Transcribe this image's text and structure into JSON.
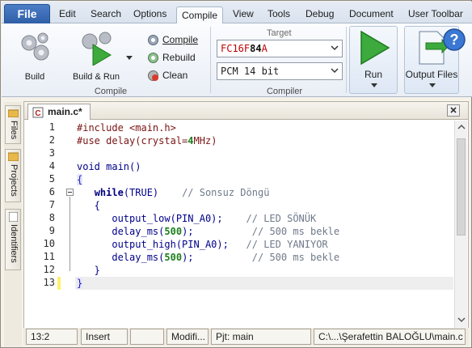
{
  "menu": {
    "file": "File",
    "tabs": [
      "Edit",
      "Search",
      "Options",
      "Compile",
      "View",
      "Tools",
      "Debug",
      "Document",
      "User Toolbar"
    ],
    "active_tab": "Compile"
  },
  "ribbon": {
    "build": "Build",
    "build_run": "Build & Run",
    "compile": "Compile",
    "rebuild": "Rebuild",
    "clean": "Clean",
    "compile_group": "Compile",
    "target_label": "Target",
    "target_value_prefix": "F",
    "target_value_mid": "C16F",
    "target_value_strong": "84",
    "target_value_suffix": "A",
    "compiler_value": "PCM 14 bit",
    "compiler_group": "Compiler",
    "run": "Run",
    "output_files": "Output Files"
  },
  "sidebar": {
    "files": "Files",
    "projects": "Projects",
    "identifiers": "Identifiers"
  },
  "editor": {
    "tab_title": "main.c*",
    "line_numbers": [
      "1",
      "2",
      "3",
      "4",
      "5",
      "6",
      "7",
      "8",
      "9",
      "10",
      "11",
      "12",
      "13"
    ],
    "code": {
      "l1_pre": "#include",
      "l1_rest": " <main.h>",
      "l2_pre": "#use",
      "l2_a": " delay(crystal=",
      "l2_num": "4",
      "l2_b": "MHz)",
      "l4_kw": "void",
      "l4_rest": " main()",
      "l5": "{",
      "l6_kw": "while",
      "l6_rest": "(TRUE)    ",
      "l6_cm": "// Sonsuz Döngü",
      "l7": "   {",
      "l8_code": "      output_low(PIN_A0);    ",
      "l8_cm": "// LED SÖNÜK",
      "l9_a": "      delay_ms(",
      "l9_num": "500",
      "l9_b": ");          ",
      "l9_cm": "// 500 ms bekle",
      "l10_code": "      output_high(PIN_A0);   ",
      "l10_cm": "// LED YANIYOR",
      "l11_a": "      delay_ms(",
      "l11_num": "500",
      "l11_b": ");          ",
      "l11_cm": "// 500 ms bekle",
      "l12": "   }",
      "l13": "}"
    }
  },
  "status": {
    "position": "13:2",
    "mode": "Insert",
    "blank": "",
    "modified": "Modifi...",
    "project": "Pjt: main",
    "path": "C:\\...\\Şerafettin BALOĞLU\\main.c"
  },
  "colors": {
    "file_tab": "#2f5fa7",
    "run_green": "#3caa3c",
    "line_marker": "#fff16b"
  }
}
